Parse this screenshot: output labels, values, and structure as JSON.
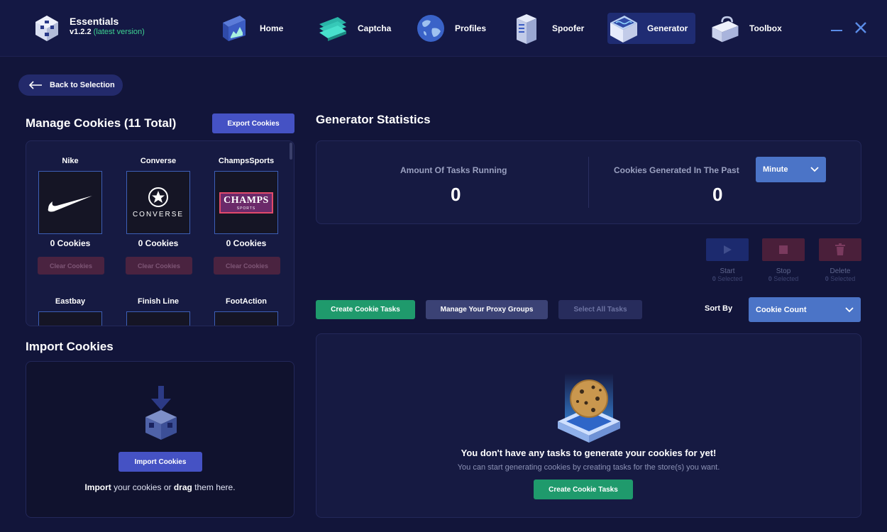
{
  "app": {
    "name": "Essentials",
    "version": "v1.2.2",
    "version_note": "(latest version)"
  },
  "nav": [
    {
      "label": "Home",
      "icon": "home-icon"
    },
    {
      "label": "Captcha",
      "icon": "captcha-icon"
    },
    {
      "label": "Profiles",
      "icon": "globe-icon"
    },
    {
      "label": "Spoofer",
      "icon": "server-icon"
    },
    {
      "label": "Generator",
      "icon": "generator-icon",
      "active": true
    },
    {
      "label": "Toolbox",
      "icon": "toolbox-icon"
    }
  ],
  "back_label": "Back to Selection",
  "manage": {
    "title": "Manage Cookies (11 Total)",
    "export_label": "Export Cookies",
    "stores": [
      {
        "name": "Nike",
        "count": "0 Cookies",
        "clear": "Clear Cookies"
      },
      {
        "name": "Converse",
        "count": "0 Cookies",
        "clear": "Clear Cookies"
      },
      {
        "name": "ChampsSports",
        "count": "0 Cookies",
        "clear": "Clear Cookies"
      },
      {
        "name": "Eastbay"
      },
      {
        "name": "Finish Line"
      },
      {
        "name": "FootAction"
      }
    ],
    "logos": {
      "converse": "CONVERSE",
      "champs": "CHAMPS",
      "champs_sub": "SPORTS"
    }
  },
  "import": {
    "title": "Import Cookies",
    "button": "Import Cookies",
    "text_b1": "Import",
    "text_1": " your cookies or ",
    "text_b2": "drag",
    "text_2": " them here."
  },
  "stats": {
    "title": "Generator Statistics",
    "tasks_label": "Amount Of Tasks Running",
    "tasks_value": "0",
    "cookies_label": "Cookies Generated In The Past",
    "cookies_value": "0",
    "period": "Minute"
  },
  "actions": [
    {
      "label": "Start",
      "count": "0",
      "sub": "Selected",
      "color": "#1c2a6e"
    },
    {
      "label": "Stop",
      "count": "0",
      "sub": "Selected",
      "color": "#4a1f3a"
    },
    {
      "label": "Delete",
      "count": "0",
      "sub": "Selected",
      "color": "#4a1f3a"
    }
  ],
  "toolbar": {
    "create": "Create Cookie Tasks",
    "proxy": "Manage Your Proxy Groups",
    "select_all": "Select All Tasks",
    "sort_label": "Sort By",
    "sort_value": "Cookie Count"
  },
  "empty": {
    "title": "You don't have any tasks to generate your cookies for yet!",
    "subtitle": "You can start generating cookies by creating tasks for the store(s) you want.",
    "button": "Create Cookie Tasks"
  }
}
